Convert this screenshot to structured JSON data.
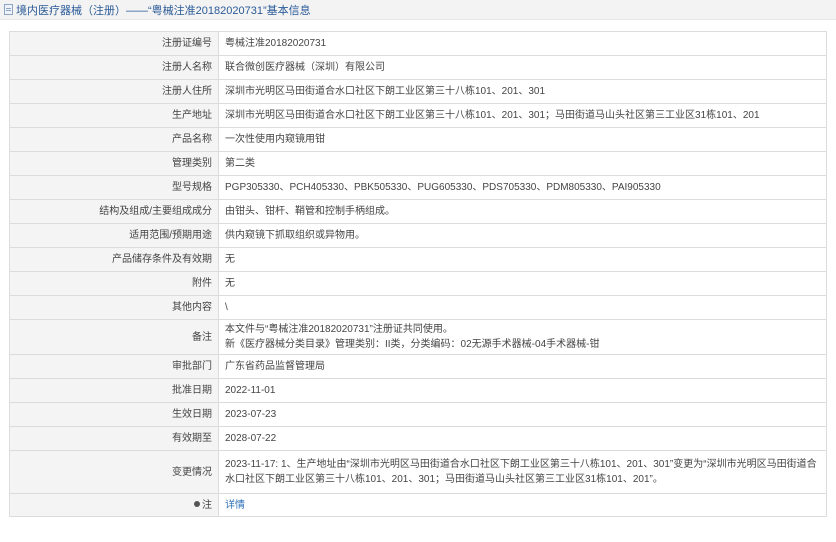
{
  "header": {
    "breadcrumb": "境内医疗器械（注册）——“粤械注准20182020731”基本信息"
  },
  "fields": {
    "reg_no": {
      "label": "注册证编号",
      "value": "粤械注准20182020731"
    },
    "registrant": {
      "label": "注册人名称",
      "value": "联合微创医疗器械（深圳）有限公司"
    },
    "registrant_addr": {
      "label": "注册人住所",
      "value": "深圳市光明区马田街道合水口社区下朗工业区第三十八栋101、201、301"
    },
    "production_addr": {
      "label": "生产地址",
      "value": "深圳市光明区马田街道合水口社区下朗工业区第三十八栋101、201、301；马田街道马山头社区第三工业区31栋101、201"
    },
    "product_name": {
      "label": "产品名称",
      "value": "一次性使用内窥镜用钳"
    },
    "category": {
      "label": "管理类别",
      "value": "第二类"
    },
    "models": {
      "label": "型号规格",
      "value": "PGP305330、PCH405330、PBK505330、PUG605330、PDS705330、PDM805330、PAI905330"
    },
    "structure": {
      "label": "结构及组成/主要组成成分",
      "value": "由钳头、钳杆、鞘管和控制手柄组成。"
    },
    "scope": {
      "label": "适用范围/预期用途",
      "value": "供内窥镜下抓取组织或异物用。"
    },
    "storage": {
      "label": "产品储存条件及有效期",
      "value": "无"
    },
    "attachment": {
      "label": "附件",
      "value": "无"
    },
    "other": {
      "label": "其他内容",
      "value": "\\"
    },
    "remarks": {
      "label": "备注",
      "line1": "本文件与“粤械注准20182020731”注册证共同使用。",
      "line2": "新《医疗器械分类目录》管理类别：II类，分类编码：02无源手术器械-04手术器械-钳"
    },
    "approver": {
      "label": "审批部门",
      "value": "广东省药品监督管理局"
    },
    "approve_date": {
      "label": "批准日期",
      "value": "2022-11-01"
    },
    "effective_date": {
      "label": "生效日期",
      "value": "2023-07-23"
    },
    "expiry": {
      "label": "有效期至",
      "value": "2028-07-22"
    },
    "changes": {
      "label": "变更情况",
      "value": "2023-11-17: 1、生产地址由“深圳市光明区马田街道合水口社区下朗工业区第三十八栋101、201、301”变更为“深圳市光明区马田街道合水口社区下朗工业区第三十八栋101、201、301；马田街道马山头社区第三工业区31栋101、201”。"
    },
    "note": {
      "label": "注",
      "value": "详情"
    }
  }
}
